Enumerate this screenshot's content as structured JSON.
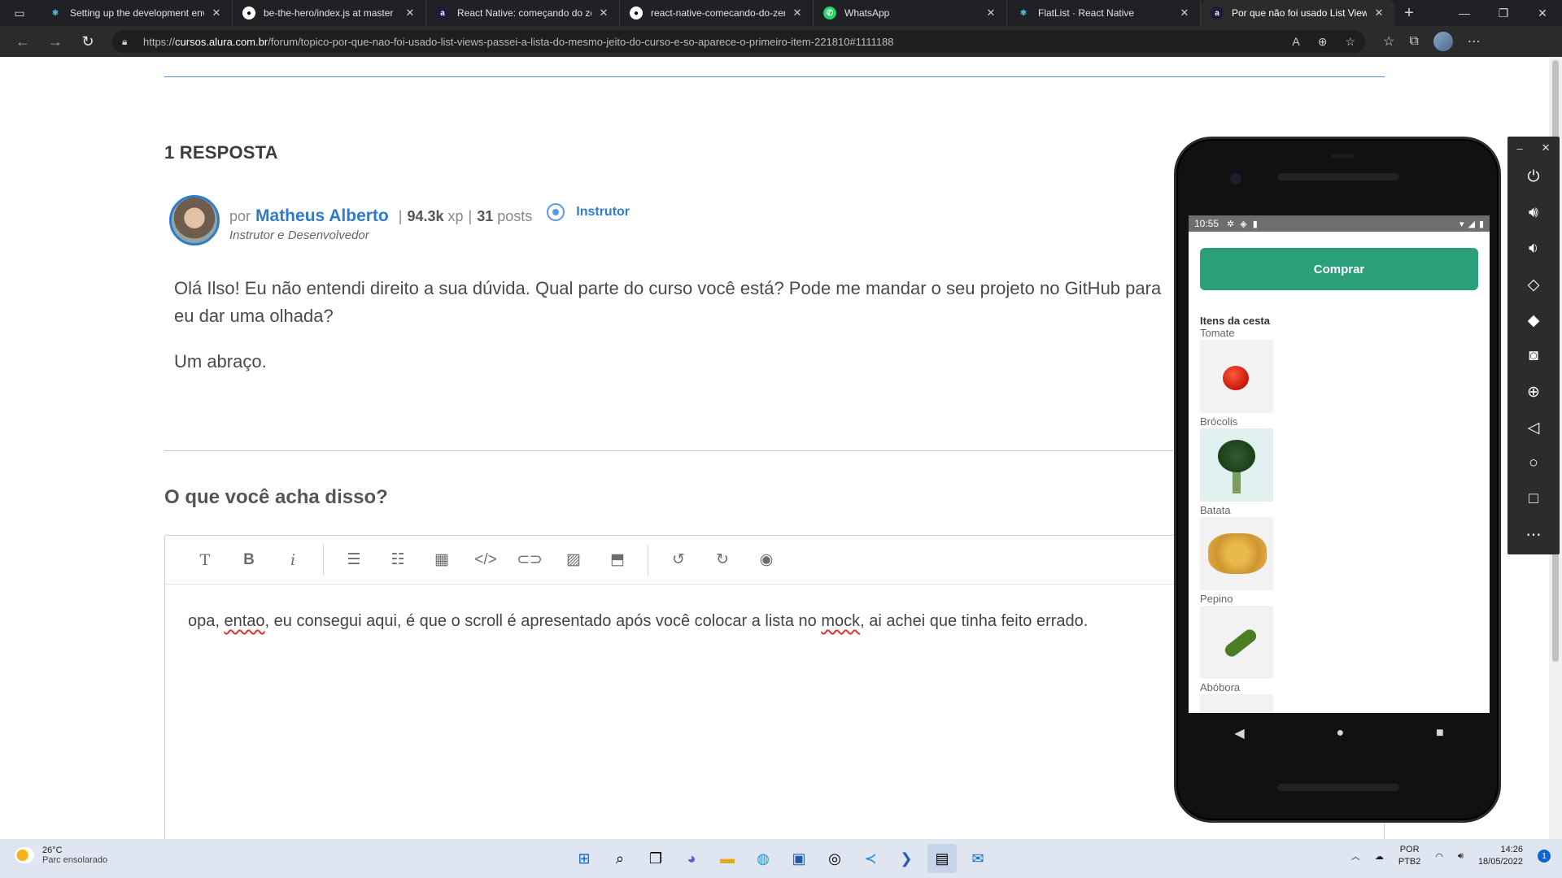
{
  "browser": {
    "tabs": [
      {
        "title": "Setting up the development env",
        "favicon": "react-icon",
        "color": "#61dafb",
        "active": false
      },
      {
        "title": "be-the-hero/index.js at master",
        "favicon": "github-icon",
        "color": "#ffffff",
        "active": false
      },
      {
        "title": "React Native: começando do zer",
        "favicon": "alura-icon",
        "color": "#1c1c3a",
        "active": false
      },
      {
        "title": "react-native-comecando-do-zer",
        "favicon": "github-icon",
        "color": "#ffffff",
        "active": false
      },
      {
        "title": "WhatsApp",
        "favicon": "whatsapp-icon",
        "color": "#25d366",
        "active": false
      },
      {
        "title": "FlatList · React Native",
        "favicon": "react-icon",
        "color": "#61dafb",
        "active": false
      },
      {
        "title": "Por que não foi usado List View",
        "favicon": "alura-icon",
        "color": "#1c1c3a",
        "active": true
      }
    ],
    "url_prefix": "https://",
    "url_host": "cursos.alura.com.br",
    "url_path": "/forum/topico-por-que-nao-foi-usado-list-views-passei-a-lista-do-mesmo-jeito-do-curso-e-so-aparece-o-primeiro-item-221810#1111188"
  },
  "forum": {
    "answers_count": "1 RESPOSTA",
    "answer": {
      "by": "por",
      "author": "Matheus Alberto",
      "xp": "94.3k",
      "xp_unit": "xp",
      "posts": "31",
      "posts_unit": "posts",
      "badge": "Instrutor",
      "role": "Instrutor e Desenvolvedor",
      "paragraphs": [
        "Olá Ilso! Eu não entendi direito a sua dúvida. Qual parte do curso você está? Pode me mandar o seu projeto no GitHub para eu dar uma olhada?",
        "Um abraço."
      ]
    },
    "reply_title": "O que você acha disso?",
    "editor": {
      "tools": [
        "text-icon",
        "bold-icon",
        "italic-icon",
        "ordered-list-icon",
        "bullet-list-icon",
        "table-icon",
        "code-icon",
        "link-icon",
        "image-icon",
        "image-upload-icon",
        "undo-icon",
        "redo-icon",
        "preview-icon"
      ],
      "text_before": "opa, ",
      "word1": "entao",
      "text_middle": ", eu consegui aqui, é que o scroll é apresentado após você colocar a lista no ",
      "word2": "mock",
      "text_after": ", ai achei que tinha feito errado."
    }
  },
  "emulator": {
    "time": "10:55",
    "buy_button": "Comprar",
    "basket_title": "Itens da cesta",
    "items": [
      "Tomate",
      "Brócolis",
      "Batata",
      "Pepino",
      "Abóbora"
    ],
    "accent_color": "#2a9f79",
    "side_controls": [
      "power-icon",
      "volume-up-icon",
      "volume-down-icon",
      "rotate-left-icon",
      "rotate-right-icon",
      "camera-icon",
      "zoom-icon",
      "back-icon",
      "home-icon",
      "overview-icon",
      "more-icon"
    ]
  },
  "taskbar": {
    "temperature": "26°C",
    "weather": "Parc ensolarado",
    "lang_line1": "POR",
    "lang_line2": "PTB2",
    "time": "14:26",
    "date": "18/05/2022",
    "notifications": "1"
  }
}
